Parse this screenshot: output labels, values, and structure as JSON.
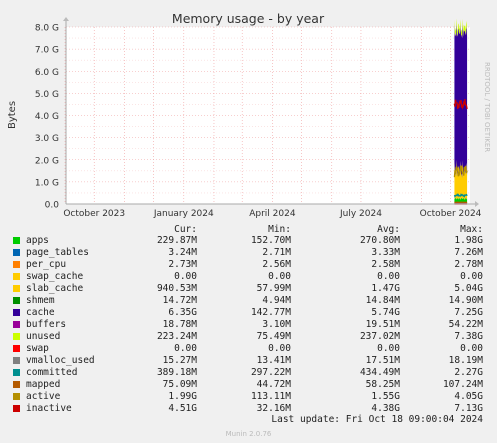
{
  "chart_data": {
    "type": "area",
    "title": "Memory usage - by year",
    "ylabel": "Bytes",
    "side_label": "RRDTOOL / TOBI OETIKER",
    "ylim": [
      0,
      8.0
    ],
    "yunit": "G",
    "y_ticks": [
      "0.0",
      "1.0 G",
      "2.0 G",
      "3.0 G",
      "4.0 G",
      "5.0 G",
      "6.0 G",
      "7.0 G",
      "8.0 G"
    ],
    "x_ticks": [
      "October 2023",
      "January 2024",
      "April 2024",
      "July 2024",
      "October 2024"
    ],
    "grid": true,
    "data_start": "2024-10-05",
    "data_end": "2024-10-18",
    "series": [
      {
        "name": "apps",
        "color": "#00cc00",
        "approx_value_g": 0.23
      },
      {
        "name": "page_tables",
        "color": "#0066b3",
        "approx_value_g": 0.003
      },
      {
        "name": "per_cpu",
        "color": "#ff8000",
        "approx_value_g": 0.003
      },
      {
        "name": "swap_cache",
        "color": "#ffcc00",
        "approx_value_g": 0.0
      },
      {
        "name": "slab_cache",
        "color": "#ffcc00",
        "approx_value_g": 0.94
      },
      {
        "name": "shmem",
        "color": "#008f00",
        "approx_value_g": 0.015
      },
      {
        "name": "cache",
        "color": "#330099",
        "approx_value_g": 6.35
      },
      {
        "name": "buffers",
        "color": "#990099",
        "approx_value_g": 0.019
      },
      {
        "name": "unused",
        "color": "#ccff00",
        "approx_value_g": 0.22
      },
      {
        "name": "swap",
        "color": "#ff0000",
        "approx_value_g": 0.0
      },
      {
        "name": "vmalloc_used",
        "color": "#808080",
        "approx_value_g": 0.015
      },
      {
        "name": "committed",
        "color": "#008f8f",
        "approx_value_g": 0.39
      },
      {
        "name": "mapped",
        "color": "#b35a00",
        "approx_value_g": 0.075
      },
      {
        "name": "active",
        "color": "#b38f00",
        "approx_value_g": 1.99
      },
      {
        "name": "inactive",
        "color": "#cc0000",
        "approx_value_g": 4.51
      }
    ]
  },
  "legend": {
    "headers": {
      "cur": "Cur:",
      "min": "Min:",
      "avg": "Avg:",
      "max": "Max:"
    },
    "rows": [
      {
        "label": "apps",
        "color": "#00cc00",
        "cur": "229.87M",
        "min": "152.70M",
        "avg": "270.80M",
        "max": "1.98G"
      },
      {
        "label": "page_tables",
        "color": "#0066b3",
        "cur": "3.24M",
        "min": "2.71M",
        "avg": "3.33M",
        "max": "7.26M"
      },
      {
        "label": "per_cpu",
        "color": "#ff8000",
        "cur": "2.73M",
        "min": "2.56M",
        "avg": "2.58M",
        "max": "2.78M"
      },
      {
        "label": "swap_cache",
        "color": "#ffcc00",
        "cur": "0.00",
        "min": "0.00",
        "avg": "0.00",
        "max": "0.00"
      },
      {
        "label": "slab_cache",
        "color": "#ffcc00",
        "cur": "940.53M",
        "min": "57.99M",
        "avg": "1.47G",
        "max": "5.04G"
      },
      {
        "label": "shmem",
        "color": "#008f00",
        "cur": "14.72M",
        "min": "4.94M",
        "avg": "14.84M",
        "max": "14.90M"
      },
      {
        "label": "cache",
        "color": "#330099",
        "cur": "6.35G",
        "min": "142.77M",
        "avg": "5.74G",
        "max": "7.25G"
      },
      {
        "label": "buffers",
        "color": "#990099",
        "cur": "18.78M",
        "min": "3.10M",
        "avg": "19.51M",
        "max": "54.22M"
      },
      {
        "label": "unused",
        "color": "#ccff00",
        "cur": "223.24M",
        "min": "75.49M",
        "avg": "237.02M",
        "max": "7.38G"
      },
      {
        "label": "swap",
        "color": "#ff0000",
        "cur": "0.00",
        "min": "0.00",
        "avg": "0.00",
        "max": "0.00"
      },
      {
        "label": "vmalloc_used",
        "color": "#808080",
        "cur": "15.27M",
        "min": "13.41M",
        "avg": "17.51M",
        "max": "18.19M"
      },
      {
        "label": "committed",
        "color": "#008f8f",
        "cur": "389.18M",
        "min": "297.22M",
        "avg": "434.49M",
        "max": "2.27G"
      },
      {
        "label": "mapped",
        "color": "#b35a00",
        "cur": "75.09M",
        "min": "44.72M",
        "avg": "58.25M",
        "max": "107.24M"
      },
      {
        "label": "active",
        "color": "#b38f00",
        "cur": "1.99G",
        "min": "113.11M",
        "avg": "1.55G",
        "max": "4.05G"
      },
      {
        "label": "inactive",
        "color": "#cc0000",
        "cur": "4.51G",
        "min": "32.16M",
        "avg": "4.38G",
        "max": "7.13G"
      }
    ]
  },
  "footer": {
    "last_update": "Last update: Fri Oct 18 09:00:04 2024",
    "munin_version": "Munin 2.0.76"
  }
}
